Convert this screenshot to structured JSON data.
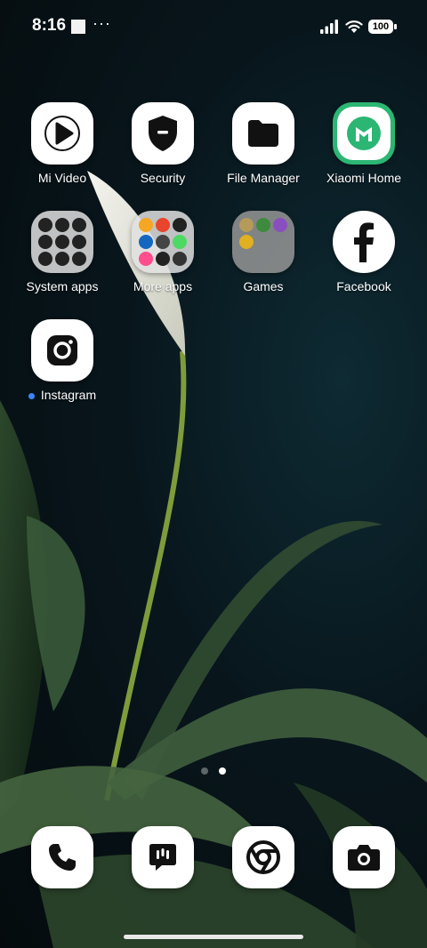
{
  "status_bar": {
    "time": "8:16",
    "notification_overflow": "···",
    "battery_level": "100"
  },
  "apps": [
    {
      "label": "Mi Video",
      "icon": "play-icon"
    },
    {
      "label": "Security",
      "icon": "shield-icon"
    },
    {
      "label": "File Manager",
      "icon": "folder-icon"
    },
    {
      "label": "Xiaomi Home",
      "icon": "xiaomi-home-icon"
    },
    {
      "label": "System apps",
      "icon": "folder-system-apps"
    },
    {
      "label": "More apps",
      "icon": "folder-more-apps"
    },
    {
      "label": "Games",
      "icon": "folder-games"
    },
    {
      "label": "Facebook",
      "icon": "facebook-icon"
    },
    {
      "label": "Instagram",
      "icon": "instagram-icon",
      "new_indicator": true
    }
  ],
  "page_indicator": {
    "total": 2,
    "current": 2
  },
  "dock": [
    {
      "name": "Phone",
      "icon": "phone-icon"
    },
    {
      "name": "Messaging",
      "icon": "message-icon"
    },
    {
      "name": "Chrome",
      "icon": "chrome-icon"
    },
    {
      "name": "Camera",
      "icon": "camera-icon"
    }
  ],
  "colors": {
    "xiaomi_home_green": "#2bb673",
    "new_dot": "#3a86ff",
    "icon_background": "#ffffff",
    "wallpaper_dark": "#08161c"
  }
}
